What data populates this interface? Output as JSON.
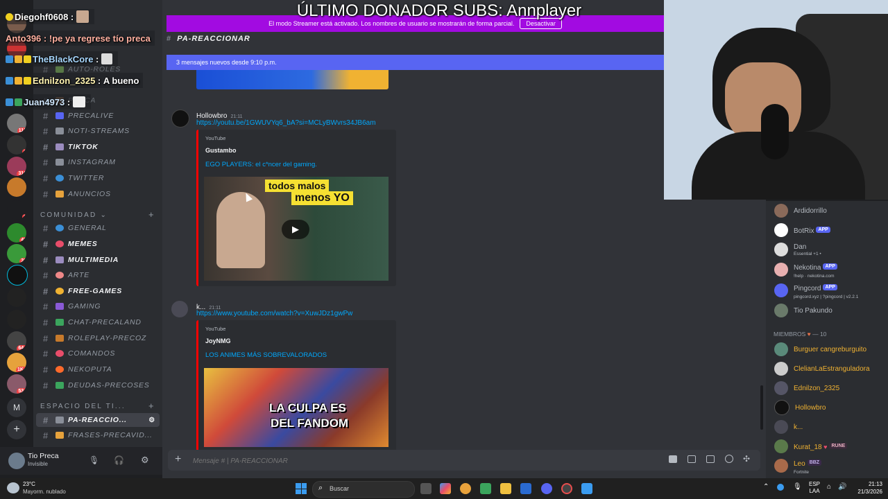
{
  "overlay": {
    "donor_text": "ÚLTIMO DONADOR SUBS: Annplayer",
    "chat": [
      {
        "name": "Diegohf0608",
        "message": ""
      },
      {
        "name": "Anto396",
        "message": "!pe ya regrese tío preca"
      },
      {
        "name": "TheBlackCore",
        "message": ""
      },
      {
        "name": "Ednilzon_2325",
        "message": "A bueno"
      },
      {
        "name": "Juan4973",
        "message": ""
      }
    ]
  },
  "banner": {
    "streamer_text": "El modo Streamer está activado. Los nombres de usuario se mostrarán de forma parcial.",
    "deactivate_label": "Desactivar",
    "new_messages": "3 mensajes nuevos desde 9:10 p.m."
  },
  "channel_header": "PA-REACCIONAR",
  "server_badges": [
    "112",
    "1",
    "316",
    "1",
    "41",
    "31",
    "644",
    "1K+",
    "534"
  ],
  "sidebar": {
    "channels_top": [
      {
        "name": "PRECALIVE",
        "bold": false
      },
      {
        "name": "NOTI-STREAMS",
        "bold": false
      },
      {
        "name": "TIKTOK",
        "bold": true
      },
      {
        "name": "INSTAGRAM",
        "bold": false
      },
      {
        "name": "TWITTER",
        "bold": false
      },
      {
        "name": "ANUNCIOS",
        "bold": false
      }
    ],
    "category_comunidad": "COMUNIDAD",
    "channels_comunidad": [
      {
        "name": "GENERAL",
        "bold": false
      },
      {
        "name": "MEMES",
        "bold": true
      },
      {
        "name": "MULTIMEDIA",
        "bold": true
      },
      {
        "name": "ARTE",
        "bold": false
      },
      {
        "name": "FREE-GAMES",
        "bold": true
      },
      {
        "name": "GAMING",
        "bold": false
      },
      {
        "name": "CHAT-PRECALAND",
        "bold": false
      },
      {
        "name": "ROLEPLAY-PRECOZ",
        "bold": false
      },
      {
        "name": "COMANDOS",
        "bold": false
      },
      {
        "name": "NEKOPUTA",
        "bold": false
      },
      {
        "name": "DEUDAS-PRECOSES",
        "bold": false
      }
    ],
    "category_espacio": "ESPACIO DEL TI...",
    "channels_espacio": [
      {
        "name": "PA-REACCIO...",
        "selected": true
      },
      {
        "name": "FRASES-PRECAVID...",
        "selected": false
      }
    ],
    "hidden_rows": [
      "AUTO-ROLES",
      "PRECA"
    ]
  },
  "user": {
    "name": "Tio Preca",
    "status": "Invisible"
  },
  "messages": [
    {
      "author": "Hollowbro",
      "time": "21:11",
      "link": "https://youtu.be/1GWUVYq6_bA?si=MCLyBWvrs34JB6am",
      "provider": "YouTube",
      "channel": "Gustambo",
      "title": "EGO PLAYERS: el c*ncer del gaming.",
      "thumb_text_1": "todos malos",
      "thumb_text_2": "menos YO"
    },
    {
      "author": "k...",
      "time": "21:11",
      "link": "https://www.youtube.com/watch?v=XuwJDz1gwPw",
      "provider": "YouTube",
      "channel": "JoyNMG",
      "title": "LOS ANIMES MÁS SOBREVALORADOS",
      "thumb_text_1": "LA CULPA ES",
      "thumb_text_2": "DEL FANDOM"
    }
  ],
  "composer": {
    "placeholder": "Mensaje # | PA-REACCIONAR"
  },
  "members": {
    "top": [
      {
        "name": "Ardidorrillo",
        "sub": "",
        "tag": "",
        "color": "#b5bac1"
      },
      {
        "name": "BotRix",
        "sub": "",
        "tag": "APP",
        "color": "#b5bac1"
      },
      {
        "name": "Dan",
        "sub": "Essential +1 •",
        "tag": "",
        "color": "#b5bac1"
      },
      {
        "name": "Nekotina",
        "sub": "!help · nekotina.com",
        "tag": "APP",
        "color": "#b5bac1"
      },
      {
        "name": "Pingcord",
        "sub": "pingcord.xyz | ?pingcord | v2.2.1",
        "tag": "APP",
        "color": "#b5bac1"
      },
      {
        "name": "Tio Pakundo",
        "sub": "",
        "tag": "",
        "color": "#b5bac1"
      }
    ],
    "section_label": "MIEMBROS",
    "section_count": "— 10",
    "list": [
      {
        "name": "Burguer cangreburguito",
        "sub": "",
        "tag": "",
        "color": "#f0b232"
      },
      {
        "name": "ClelianLaEstranguladora",
        "sub": "",
        "tag": "",
        "color": "#f0b232"
      },
      {
        "name": "Ednilzon_2325",
        "sub": "",
        "tag": "",
        "color": "#f0b232"
      },
      {
        "name": "Hollowbro",
        "sub": "",
        "tag": "",
        "color": "#f0b232"
      },
      {
        "name": "k...",
        "sub": "",
        "tag": "",
        "color": "#f0b232"
      },
      {
        "name": "Kurat_18",
        "sub": "",
        "tag": "RUNE",
        "color": "#f0b232"
      },
      {
        "name": "Leo",
        "sub": "Fortnite",
        "tag": "BBZ",
        "color": "#f0b232"
      }
    ]
  },
  "taskbar": {
    "weather_temp": "23°C",
    "weather_desc": "Mayorm. nublado",
    "search_label": "Buscar",
    "lang_1": "ESP",
    "lang_2": "LAA",
    "time": "21:13",
    "date": "21/3/2026"
  },
  "colors": {
    "accent": "#5865f2",
    "streamer": "#a20be1",
    "youtube": "#ff0000",
    "link": "#00a8fc"
  }
}
